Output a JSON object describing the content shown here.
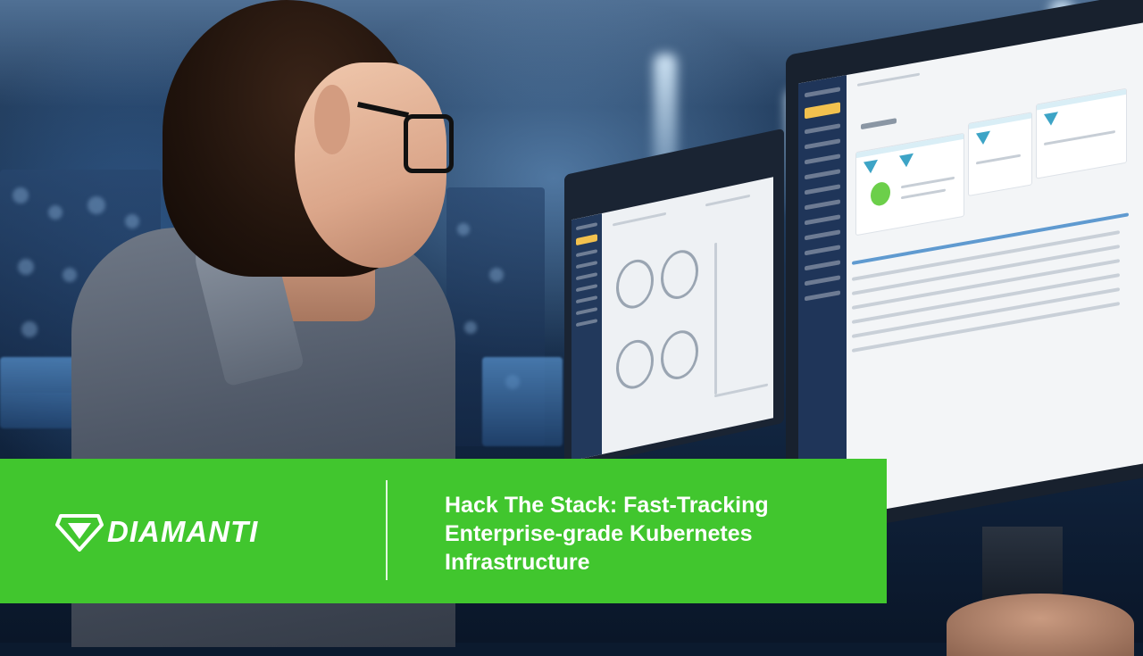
{
  "banner": {
    "logo_text": "DIAMANTI",
    "headline_lines": [
      "Hack The Stack: Fast-Tracking",
      "Enterprise-grade Kubernetes",
      "Infrastructure"
    ]
  },
  "colors": {
    "banner_green": "#41c62e",
    "text_white": "#ffffff",
    "dashboard_sidebar": "#1f3559"
  },
  "icons": {
    "logo_mark": "diamond-logo-icon"
  }
}
